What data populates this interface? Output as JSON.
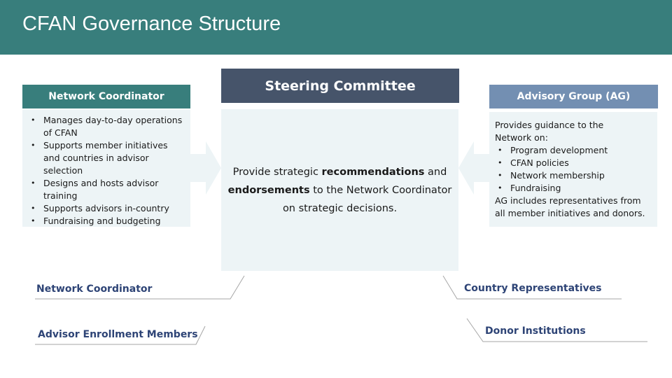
{
  "header": {
    "title": "CFAN Governance Structure"
  },
  "colors": {
    "title_bar": "#387e7c",
    "network_coordinator": "#387e7c",
    "steering_committee": "#46546a",
    "advisory_group": "#738fb2",
    "panel_body": "#edf4f6",
    "label_text": "#2e4476"
  },
  "network_coordinator": {
    "title": "Network Coordinator",
    "items": [
      "Manages day-to-day operations of CFAN",
      "Supports member initiatives and countries in advisor selection",
      "Designs and hosts advisor training",
      "Supports advisors in-country",
      "Fundraising and budgeting"
    ]
  },
  "steering_committee": {
    "title": "Steering Committee",
    "text_part1": "Provide strategic ",
    "text_bold1": "recommendations",
    "text_part2": " and ",
    "text_bold2": "endorsements",
    "text_part3": " to the Network Coordinator on strategic decisions."
  },
  "advisory_group": {
    "title": "Advisory Group (AG)",
    "intro": "Provides guidance to the Network on:",
    "items": [
      "Program development",
      "CFAN policies",
      "Network membership",
      "Fundraising"
    ],
    "footer": "AG includes representatives from all member initiatives and donors."
  },
  "members": {
    "left": [
      "Network Coordinator",
      "Advisor Enrollment Members"
    ],
    "right": [
      "Country Representatives",
      "Donor Institutions"
    ]
  }
}
